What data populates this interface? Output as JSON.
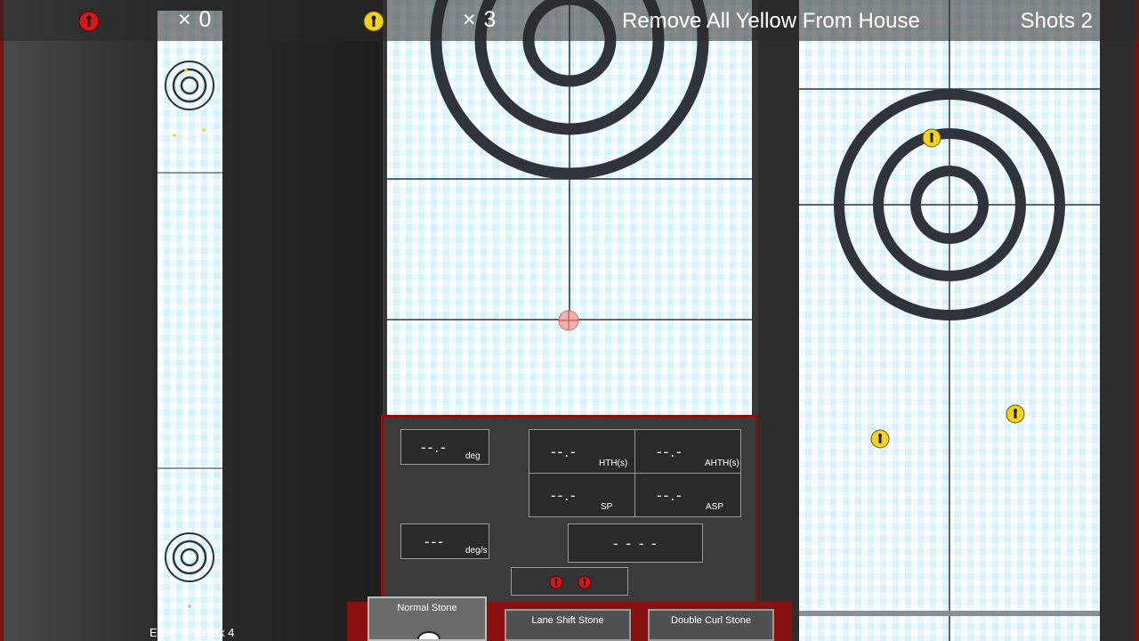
{
  "scoreboard": {
    "red_stone_icon": "red-stone-icon",
    "red_count": "× 0",
    "yellow_stone_icon": "yellow-stone-icon",
    "yellow_count": "× 3"
  },
  "objective": "Remove All Yellow From House",
  "shots": "Shots  2",
  "controls": {
    "angle_value": "--.-",
    "angle_unit": "deg",
    "rotation_value": "---",
    "rotation_unit": "deg/s",
    "hth_value": "--.-",
    "hth_unit": "HTH(s)",
    "ahth_value": "--.-",
    "ahth_unit": "AHTH(s)",
    "sp_value": "--.-",
    "sp_unit": "SP",
    "asp_value": "--.-",
    "asp_unit": "ASP",
    "status_value": "- - - -",
    "remaining_stones_icon": "red-stone-icon"
  },
  "stone_types": [
    {
      "label": "Normal Stone",
      "selected": true
    },
    {
      "label": "Lane Shift Stone",
      "selected": false
    },
    {
      "label": "Double Curl Stone",
      "selected": false
    }
  ],
  "status_bar": {
    "difficulty": "Easy",
    "streak": "Streak 4"
  },
  "colors": {
    "red_stone": "#d81818",
    "yellow_stone": "#f2d21e",
    "house_ring": "#2f343a",
    "panel_border": "#8a1010",
    "ice": "#eaf8fc"
  }
}
